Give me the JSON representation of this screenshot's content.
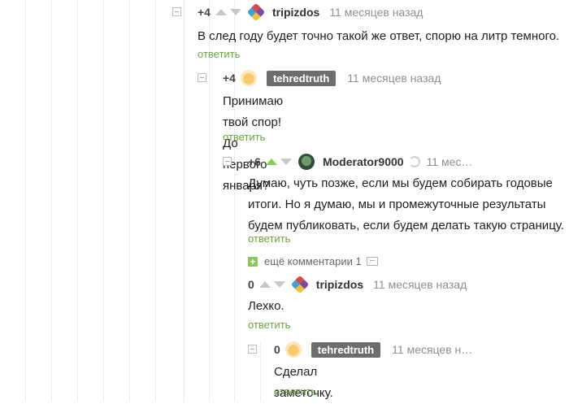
{
  "comments": [
    {
      "rating": "+4",
      "user": "tripizdos",
      "time": "11 месяцев назад",
      "text": "В след году будет точно такой же ответ, спорю на литр темного.",
      "reply": "ответить"
    },
    {
      "rating": "+4",
      "user": "tehredtruth",
      "time": "11 месяцев назад",
      "text_lines": [
        "Принимаю твой спор!",
        "До первого января?"
      ],
      "reply": "ответить"
    },
    {
      "rating": "+6",
      "user": "Moderator9000",
      "time": "11 мес…",
      "text_lines": [
        "Думаю, чуть позже, если мы будем собирать годовые",
        "итоги. Но я думаю, мы и промежуточные результаты",
        "будем публиковать, если будем делать такую страницу."
      ],
      "reply": "ответить",
      "more_comments": "ещё комментарии 1"
    },
    {
      "rating": "0",
      "user": "tripizdos",
      "time": "11 месяцев назад",
      "text": "Лехко.",
      "reply": "ответить"
    },
    {
      "rating": "0",
      "user": "tehredtruth",
      "time": "11 месяцев н…",
      "text": "Сделал заметочку.",
      "reply": "ответить"
    }
  ],
  "colors": {
    "accent_green": "#6aa33f",
    "upvote_green": "#8ac858",
    "nick_badge_bg": "#6d6d6d"
  }
}
